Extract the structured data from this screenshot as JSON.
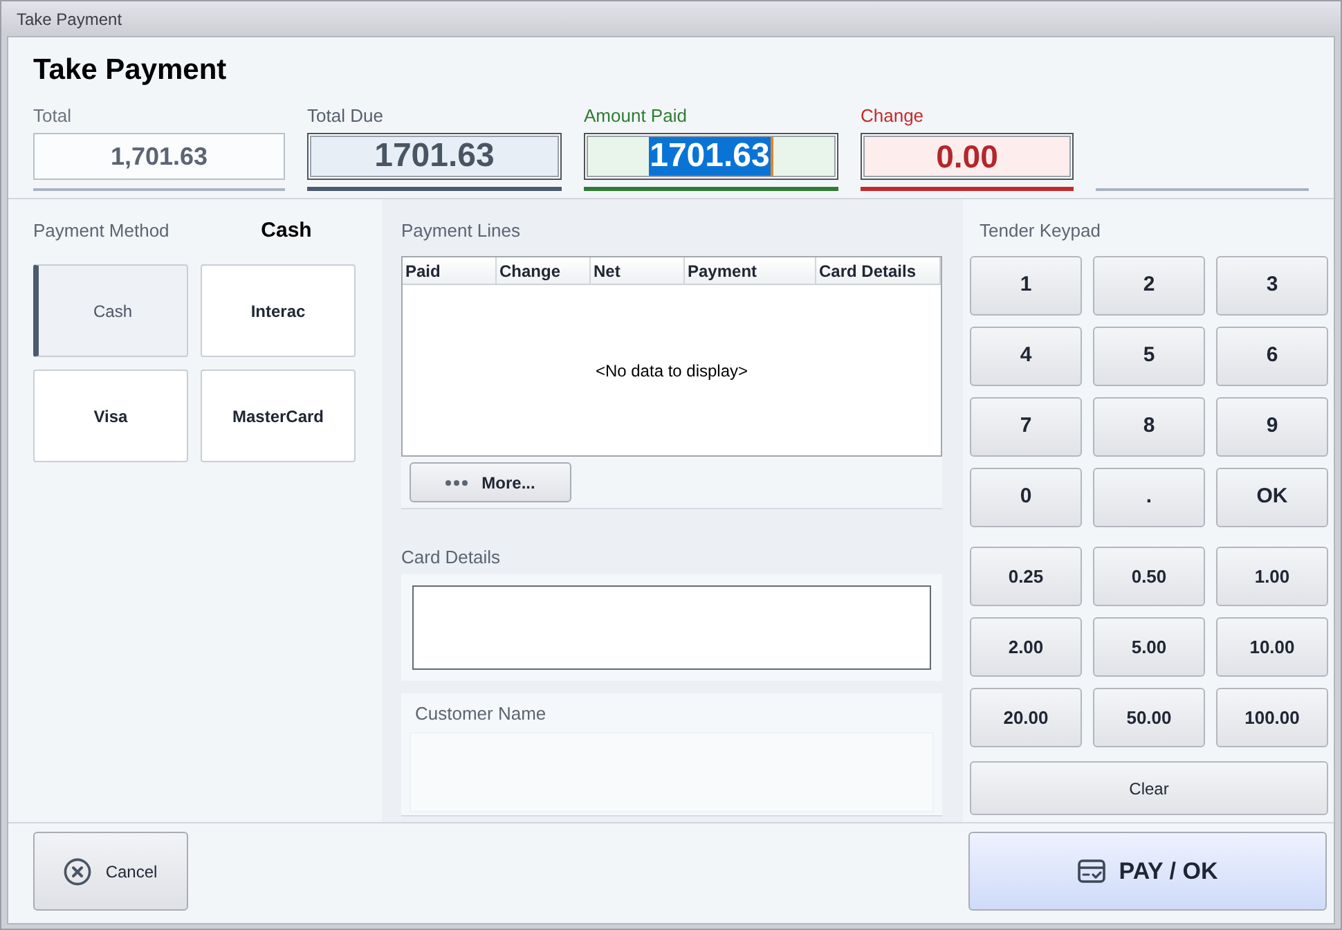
{
  "window": {
    "title": "Take Payment"
  },
  "header": {
    "title": "Take Payment"
  },
  "summary_fields": [
    {
      "kind": "readonly",
      "label": "Total",
      "value": "1,701.63"
    },
    {
      "kind": "due",
      "label": "Total Due",
      "value": "1701.63"
    },
    {
      "kind": "paid",
      "label": "Amount Paid",
      "value": "1701.63",
      "text_selected": true
    },
    {
      "kind": "change",
      "label": "Change",
      "value": "0.00"
    },
    {
      "kind": "blank"
    }
  ],
  "payment_method": {
    "label": "Payment Method",
    "current": "Cash",
    "options": [
      {
        "label": "Cash",
        "selected": true
      },
      {
        "label": "Interac",
        "selected": false
      },
      {
        "label": "Visa",
        "selected": false
      },
      {
        "label": "MasterCard",
        "selected": false
      }
    ]
  },
  "payment_lines": {
    "label": "Payment Lines",
    "columns": [
      "Paid",
      "Change",
      "Net",
      "Payment",
      "Card Details"
    ],
    "empty_text": "<No data to display>",
    "more_button": "More..."
  },
  "card_details": {
    "label": "Card Details"
  },
  "customer_name": {
    "label": "Customer Name"
  },
  "tender_keypad": {
    "label": "Tender Keypad",
    "keys": [
      "1",
      "2",
      "3",
      "4",
      "5",
      "6",
      "7",
      "8",
      "9",
      "0",
      ".",
      "OK"
    ],
    "amount_keys": [
      "0.25",
      "0.50",
      "1.00",
      "2.00",
      "5.00",
      "10.00",
      "20.00",
      "50.00",
      "100.00"
    ],
    "clear_button": "Clear"
  },
  "footer": {
    "cancel_button": "Cancel",
    "pay_button": "PAY / OK"
  }
}
